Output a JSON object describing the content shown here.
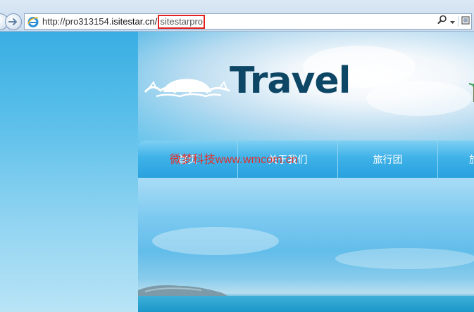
{
  "browser": {
    "url_prefix": "http://pro313154.",
    "url_domain": "isitestar.cn/",
    "url_highlight": "sitestarpro"
  },
  "site": {
    "logo_text": "Travel",
    "nav": [
      {
        "label": "首页"
      },
      {
        "label": "关于我们"
      },
      {
        "label": "旅行团"
      },
      {
        "label": "旅"
      }
    ],
    "watermark": "微梦科技www.wmcom.cn"
  },
  "colors": {
    "nav_bar": "#3fb2e8",
    "logo": "#0e4766",
    "watermark": "#e0322d",
    "url_highlight_border": "#e32020"
  }
}
